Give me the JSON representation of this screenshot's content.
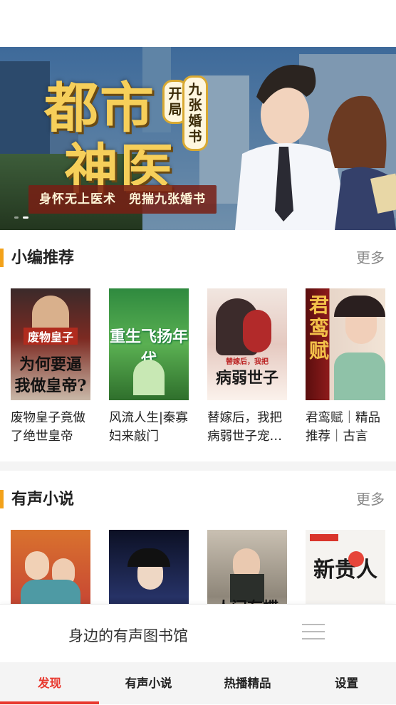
{
  "banner": {
    "title_line1": "都市",
    "title_line2": "神医",
    "tag1": "开局",
    "tag2": "九张婚书",
    "subtitle": "身怀无上医术　兜揣九张婚书"
  },
  "section_recommend": {
    "title": "小编推荐",
    "more": "更多",
    "books": [
      {
        "title": "废物皇子竟做了绝世皇帝",
        "cover_text": "为何要逼我做皇帝?",
        "cover_top": "废物皇子"
      },
      {
        "title": "风流人生|秦寡妇来敲门",
        "cover_text": "重生飞扬年代",
        "cover_top": ""
      },
      {
        "title": "替嫁后，我把病弱世子宠上天",
        "cover_text": "病弱世子",
        "cover_top": "替嫁后，我把"
      },
      {
        "title": "君鸾赋｜精品推荐｜古言",
        "cover_text": "君鸾赋",
        "cover_top": ""
      }
    ]
  },
  "section_audio": {
    "title": "有声小说",
    "more": "更多",
    "books": [
      {
        "cover_text": ""
      },
      {
        "cover_text": ""
      },
      {
        "cover_text": "人间有蝶"
      },
      {
        "cover_text": "新贵人"
      }
    ]
  },
  "player": {
    "text": "身边的有声图书馆"
  },
  "tabs": [
    {
      "label": "发现"
    },
    {
      "label": "有声小说"
    },
    {
      "label": "热播精品"
    },
    {
      "label": "设置"
    }
  ],
  "colors": {
    "accent": "#e8392f",
    "section_bar": "#f3a21a"
  }
}
